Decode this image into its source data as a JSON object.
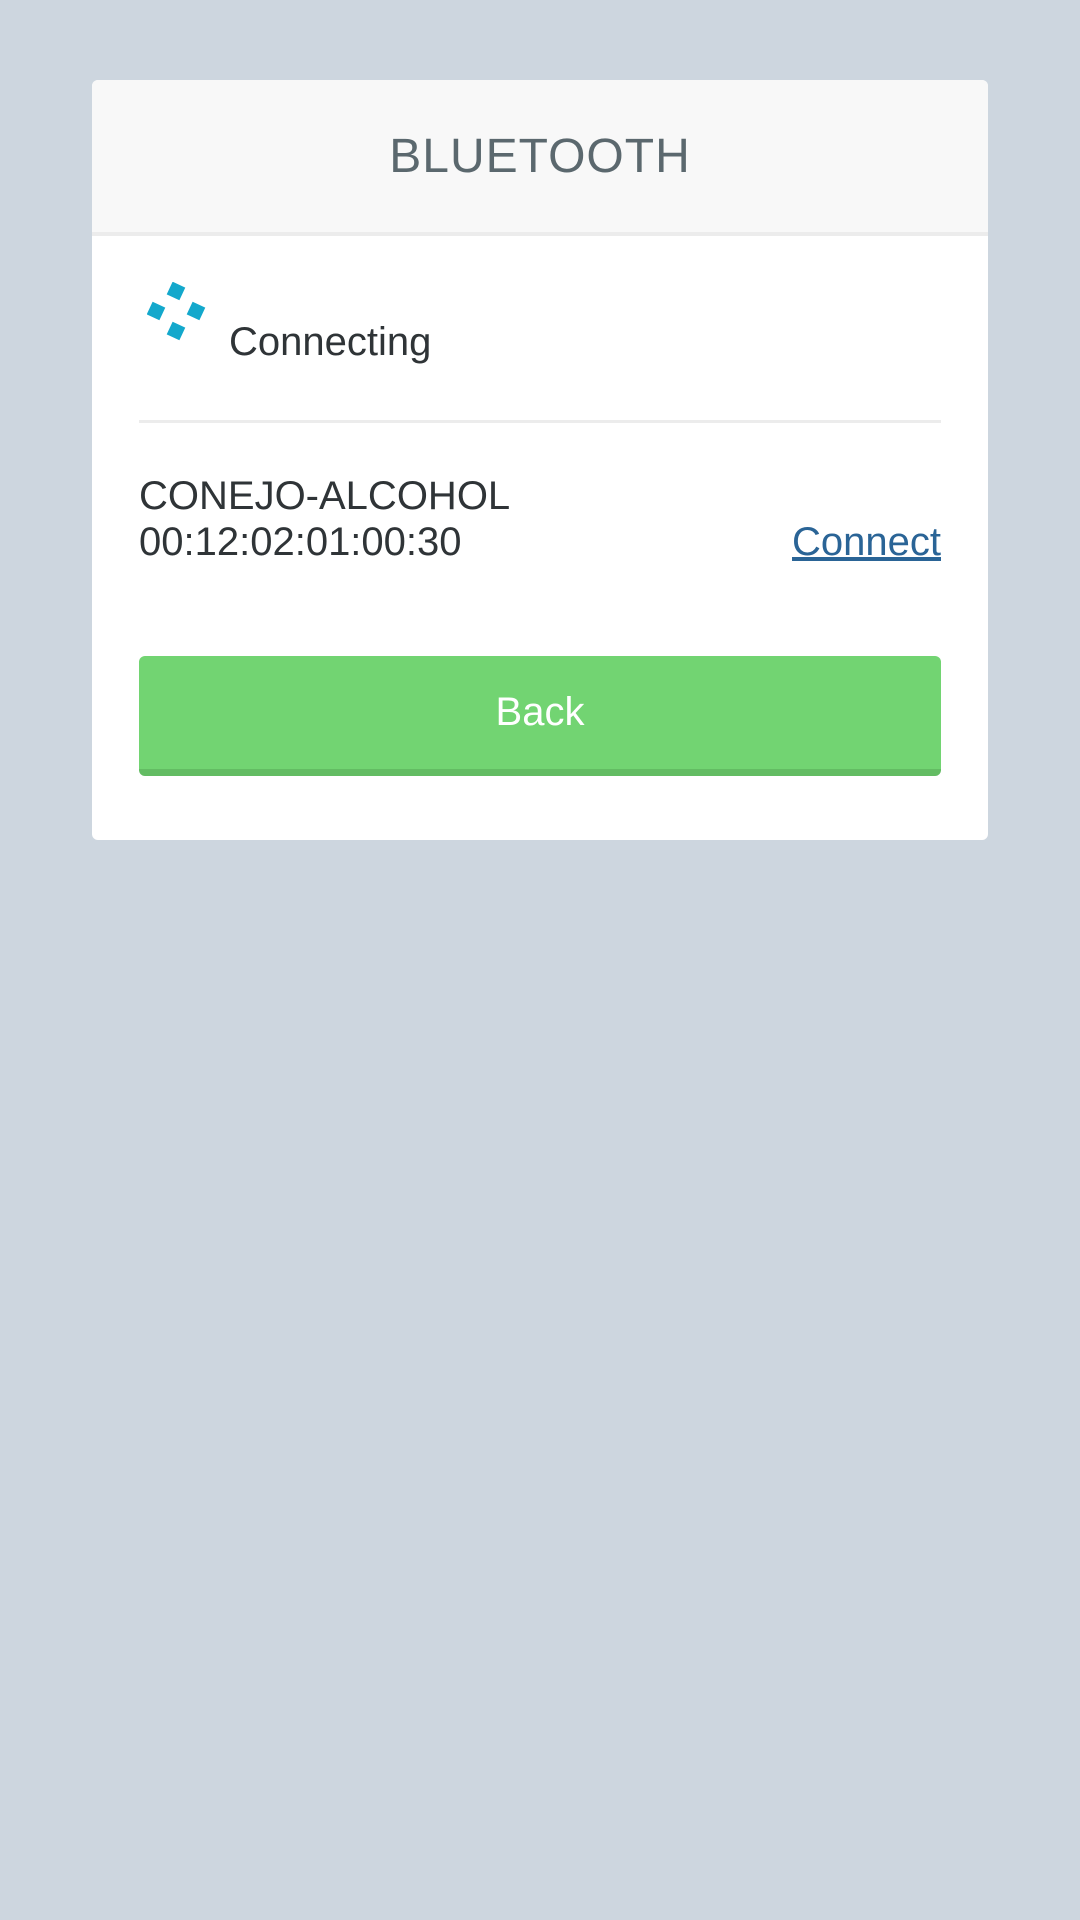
{
  "dialog": {
    "title": "BLUETOOTH"
  },
  "status": {
    "icon": "loading-spinner-icon",
    "text": "Connecting"
  },
  "device": {
    "name": "CONEJO-ALCOHOL",
    "mac": "00:12:02:01:00:30",
    "connect_label": "Connect"
  },
  "actions": {
    "back_label": "Back"
  },
  "colors": {
    "background": "#cdd6df",
    "spinner": "#13a8cc",
    "button": "#72d472",
    "link": "#2a6496"
  }
}
